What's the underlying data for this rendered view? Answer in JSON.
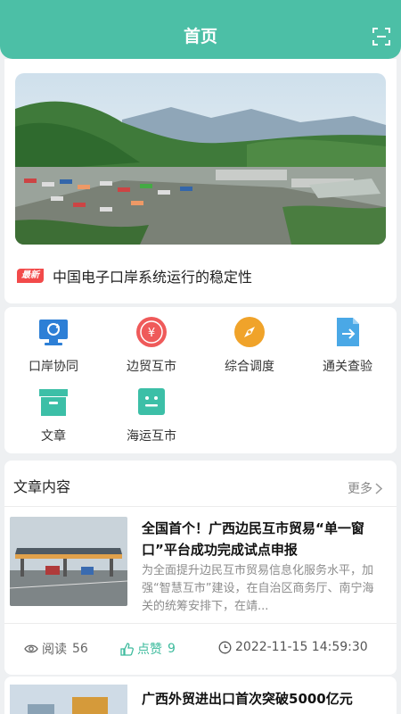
{
  "header": {
    "title": "首页",
    "scan_icon": "scan-icon"
  },
  "banner": {
    "image": "port-landscape-photo"
  },
  "news": {
    "badge": "最新",
    "text": "中国电子口岸系统运行的稳定性"
  },
  "grid": {
    "items": [
      {
        "label": "口岸协同",
        "icon": "monitor-sync-icon",
        "color": "#2d7fd6"
      },
      {
        "label": "边贸互市",
        "icon": "yen-icon",
        "color": "#ef5a5a"
      },
      {
        "label": "综合调度",
        "icon": "compass-icon",
        "color": "#f0a32a"
      },
      {
        "label": "通关查验",
        "icon": "document-export-icon",
        "color": "#4aa8e6"
      },
      {
        "label": "文章",
        "icon": "archive-box-icon",
        "color": "#3cbfa7"
      },
      {
        "label": "海运互市",
        "icon": "chat-box-icon",
        "color": "#3cbfa7"
      }
    ]
  },
  "articles_section": {
    "title": "文章内容",
    "more": "更多"
  },
  "article1": {
    "title": "全国首个！广西边民互市贸易“单一窗口”平台成功完成试点申报",
    "summary": "为全面提升边民互市贸易信息化服务水平，加强“智慧互市”建设，在自治区商务厅、南宁海关的统筹安排下，在靖...",
    "reads_label": "阅读",
    "reads": "56",
    "likes_label": "点赞",
    "likes": "9",
    "time": "2022-11-15 14:59:30"
  },
  "article2": {
    "title": "广西外贸进出口首次突破5000亿元"
  },
  "colors": {
    "accent": "#4cbfa6",
    "badge": "#f24a4a",
    "like": "#3dbb9d"
  }
}
